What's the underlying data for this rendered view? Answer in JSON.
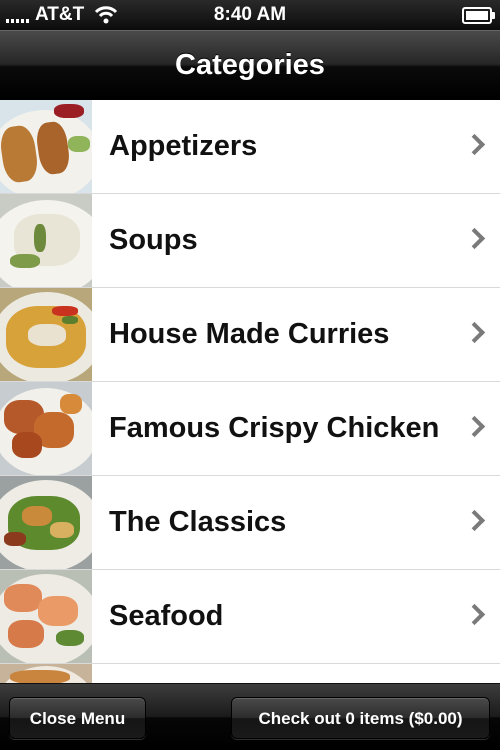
{
  "status_bar": {
    "carrier": "AT&T",
    "time": "8:40 AM",
    "icons": [
      "signal-icon",
      "wifi-icon",
      "battery-icon"
    ],
    "battery_level": 0.95
  },
  "nav": {
    "title": "Categories"
  },
  "categories": [
    {
      "label": "Appetizers",
      "icon": "food-thumbnail"
    },
    {
      "label": "Soups",
      "icon": "food-thumbnail"
    },
    {
      "label": "House Made Curries",
      "icon": "food-thumbnail"
    },
    {
      "label": "Famous Crispy Chicken",
      "icon": "food-thumbnail"
    },
    {
      "label": "The Classics",
      "icon": "food-thumbnail"
    },
    {
      "label": "Seafood",
      "icon": "food-thumbnail"
    },
    {
      "label": "",
      "icon": "food-thumbnail"
    }
  ],
  "toolbar": {
    "close_label": "Close Menu",
    "checkout_label": "Check out 0 items ($0.00)"
  },
  "colors": {
    "bar_black": "#000000",
    "list_background": "#ffffff",
    "separator": "#d9d9d9",
    "chevron": "#7a7a7a"
  }
}
